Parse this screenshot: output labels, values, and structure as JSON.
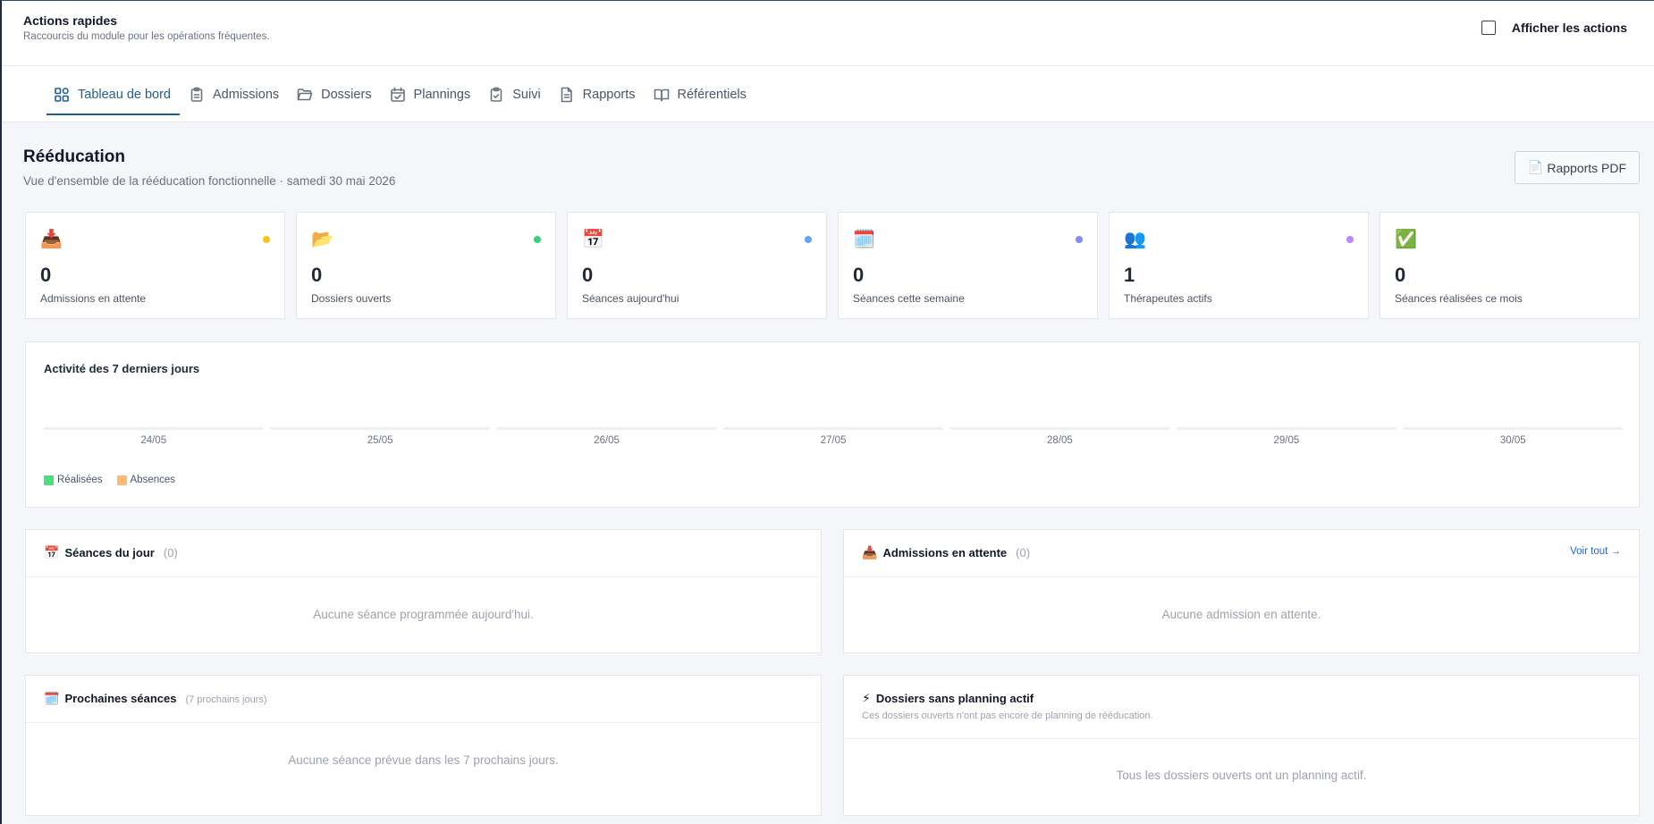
{
  "quick_actions": {
    "title": "Actions rapides",
    "subtitle": "Raccourcis du module pour les opérations fréquentes.",
    "toggle_label": "Afficher les actions",
    "toggle_checked": false
  },
  "tabs": [
    {
      "label": "Tableau de bord",
      "icon": "dashboard-grid-icon",
      "active": true
    },
    {
      "label": "Admissions",
      "icon": "clipboard-icon",
      "active": false
    },
    {
      "label": "Dossiers",
      "icon": "folder-icon",
      "active": false
    },
    {
      "label": "Plannings",
      "icon": "calendar-check-icon",
      "active": false
    },
    {
      "label": "Suivi",
      "icon": "clipboard-check-icon",
      "active": false
    },
    {
      "label": "Rapports",
      "icon": "file-text-icon",
      "active": false
    },
    {
      "label": "Référentiels",
      "icon": "book-open-icon",
      "active": false
    }
  ],
  "page": {
    "title": "Rééducation",
    "subtitle": "Vue d'ensemble de la rééducation fonctionnelle · samedi 30 mai 2026",
    "pdf_button": "Rapports PDF",
    "pdf_icon": "📄"
  },
  "stats": [
    {
      "icon": "📥",
      "value": "0",
      "label": "Admissions en attente",
      "dot_color": "#f5c518"
    },
    {
      "icon": "📂",
      "value": "0",
      "label": "Dossiers ouverts",
      "dot_color": "#34d27b"
    },
    {
      "icon": "📅",
      "value": "0",
      "label": "Séances aujourd'hui",
      "dot_color": "#60a5fa"
    },
    {
      "icon": "🗓️",
      "value": "0",
      "label": "Séances cette semaine",
      "dot_color": "#818cf8"
    },
    {
      "icon": "👥",
      "value": "1",
      "label": "Thérapeutes actifs",
      "dot_color": "#c084fc"
    },
    {
      "icon": "✅",
      "value": "0",
      "label": "Séances réalisées ce mois",
      "dot_color": null
    }
  ],
  "activity_chart": {
    "title": "Activité des 7 derniers jours",
    "legend": [
      {
        "label": "Réalisées",
        "color": "#4ade80"
      },
      {
        "label": "Absences",
        "color": "#fdba74"
      }
    ]
  },
  "chart_data": {
    "type": "bar",
    "title": "Activité des 7 derniers jours",
    "categories": [
      "24/05",
      "25/05",
      "26/05",
      "27/05",
      "28/05",
      "29/05",
      "30/05"
    ],
    "series": [
      {
        "name": "Réalisées",
        "values": [
          0,
          0,
          0,
          0,
          0,
          0,
          0
        ],
        "color": "#4ade80"
      },
      {
        "name": "Absences",
        "values": [
          0,
          0,
          0,
          0,
          0,
          0,
          0
        ],
        "color": "#fdba74"
      }
    ],
    "xlabel": "",
    "ylabel": "",
    "legend_position": "bottom-left",
    "grid": false
  },
  "panels": {
    "today": {
      "icon": "📅",
      "title": "Séances du jour",
      "count": "(0)",
      "empty": "Aucune séance programmée aujourd'hui."
    },
    "pending": {
      "icon": "📥",
      "title": "Admissions en attente",
      "count": "(0)",
      "link": "Voir tout →",
      "empty": "Aucune admission en attente."
    },
    "upcoming": {
      "icon": "🗓️",
      "title": "Prochaines séances",
      "hint": "(7 prochains jours)",
      "empty": "Aucune séance prévue dans les 7 prochains jours."
    },
    "no_planning": {
      "icon": "⚡",
      "title": "Dossiers sans planning actif",
      "description": "Ces dossiers ouverts n'ont pas encore de planning de rééducation.",
      "empty": "Tous les dossiers ouverts ont un planning actif."
    }
  }
}
